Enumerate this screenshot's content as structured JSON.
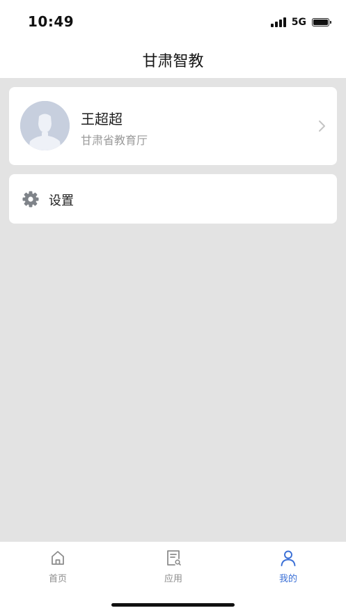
{
  "status_bar": {
    "time": "10:49",
    "network": "5G",
    "icons": [
      "cellular-signal-icon",
      "battery-icon"
    ]
  },
  "header": {
    "title": "甘肃智教"
  },
  "profile": {
    "name": "王超超",
    "organization": "甘肃省教育厅",
    "icons": [
      "avatar-placeholder-icon",
      "chevron-right-icon"
    ]
  },
  "menu": [
    {
      "label": "设置",
      "icon": "gear-icon"
    }
  ],
  "tab_bar": {
    "tabs": [
      {
        "label": "首页",
        "icon": "home-icon",
        "active": false
      },
      {
        "label": "应用",
        "icon": "document-search-icon",
        "active": false
      },
      {
        "label": "我的",
        "icon": "user-icon",
        "active": true
      }
    ],
    "active_color": "#3a6fd6",
    "inactive_color": "#8c8c8c"
  },
  "colors": {
    "background": "#e3e3e3",
    "card": "#ffffff",
    "avatar_bg": "#c7cfde"
  }
}
